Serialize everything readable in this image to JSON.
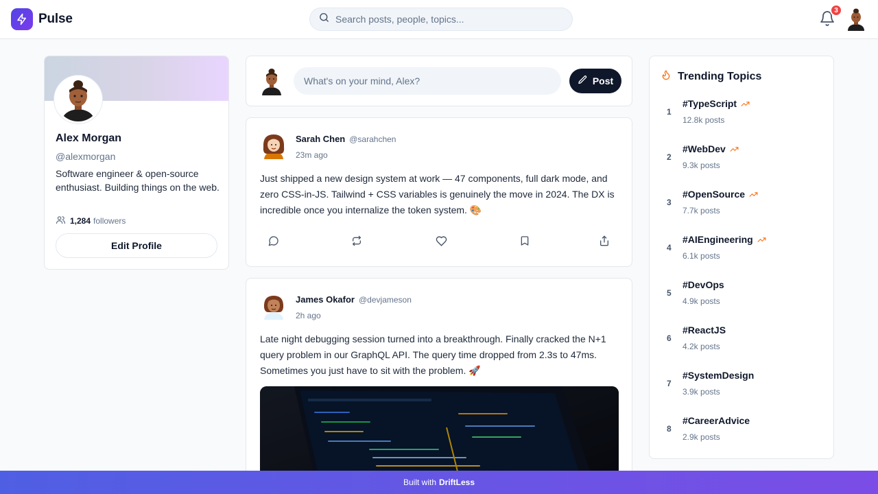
{
  "header": {
    "brand": "Pulse",
    "search_placeholder": "Search posts, people, topics...",
    "notification_count": "3"
  },
  "profile": {
    "name": "Alex Morgan",
    "handle": "@alexmorgan",
    "bio": "Software engineer & open-source enthusiast. Building things on the web.",
    "followers_count": "1,284",
    "followers_label": "followers",
    "edit_label": "Edit Profile"
  },
  "composer": {
    "placeholder": "What's on your mind, Alex?",
    "post_label": "Post"
  },
  "posts": [
    {
      "author": "Sarah Chen",
      "handle": "@sarahchen",
      "time": "23m ago",
      "text": "Just shipped a new design system at work — 47 components, full dark mode, and zero CSS-in-JS. Tailwind + CSS variables is genuinely the move in 2024. The DX is incredible once you internalize the token system. 🎨"
    },
    {
      "author": "James Okafor",
      "handle": "@devjameson",
      "time": "2h ago",
      "text": "Late night debugging session turned into a breakthrough. Finally cracked the N+1 query problem in our GraphQL API. The query time dropped from 2.3s to 47ms. Sometimes you just have to sit with the problem. 🚀"
    }
  ],
  "trending": {
    "title": "Trending Topics",
    "items": [
      {
        "rank": "1",
        "tag": "#TypeScript",
        "count": "12.8k posts",
        "rising": true
      },
      {
        "rank": "2",
        "tag": "#WebDev",
        "count": "9.3k posts",
        "rising": true
      },
      {
        "rank": "3",
        "tag": "#OpenSource",
        "count": "7.7k posts",
        "rising": true
      },
      {
        "rank": "4",
        "tag": "#AIEngineering",
        "count": "6.1k posts",
        "rising": true
      },
      {
        "rank": "5",
        "tag": "#DevOps",
        "count": "4.9k posts",
        "rising": false
      },
      {
        "rank": "6",
        "tag": "#ReactJS",
        "count": "4.2k posts",
        "rising": false
      },
      {
        "rank": "7",
        "tag": "#SystemDesign",
        "count": "3.9k posts",
        "rising": false
      },
      {
        "rank": "8",
        "tag": "#CareerAdvice",
        "count": "2.9k posts",
        "rising": false
      }
    ]
  },
  "footer": {
    "prefix": "Built with",
    "name": "DriftLess"
  },
  "colors": {
    "brand_gradient_start": "#4f46e5",
    "brand_gradient_end": "#7c3aed",
    "primary_button": "#0f172a",
    "badge": "#ef4444",
    "trend_accent": "#f97316"
  }
}
